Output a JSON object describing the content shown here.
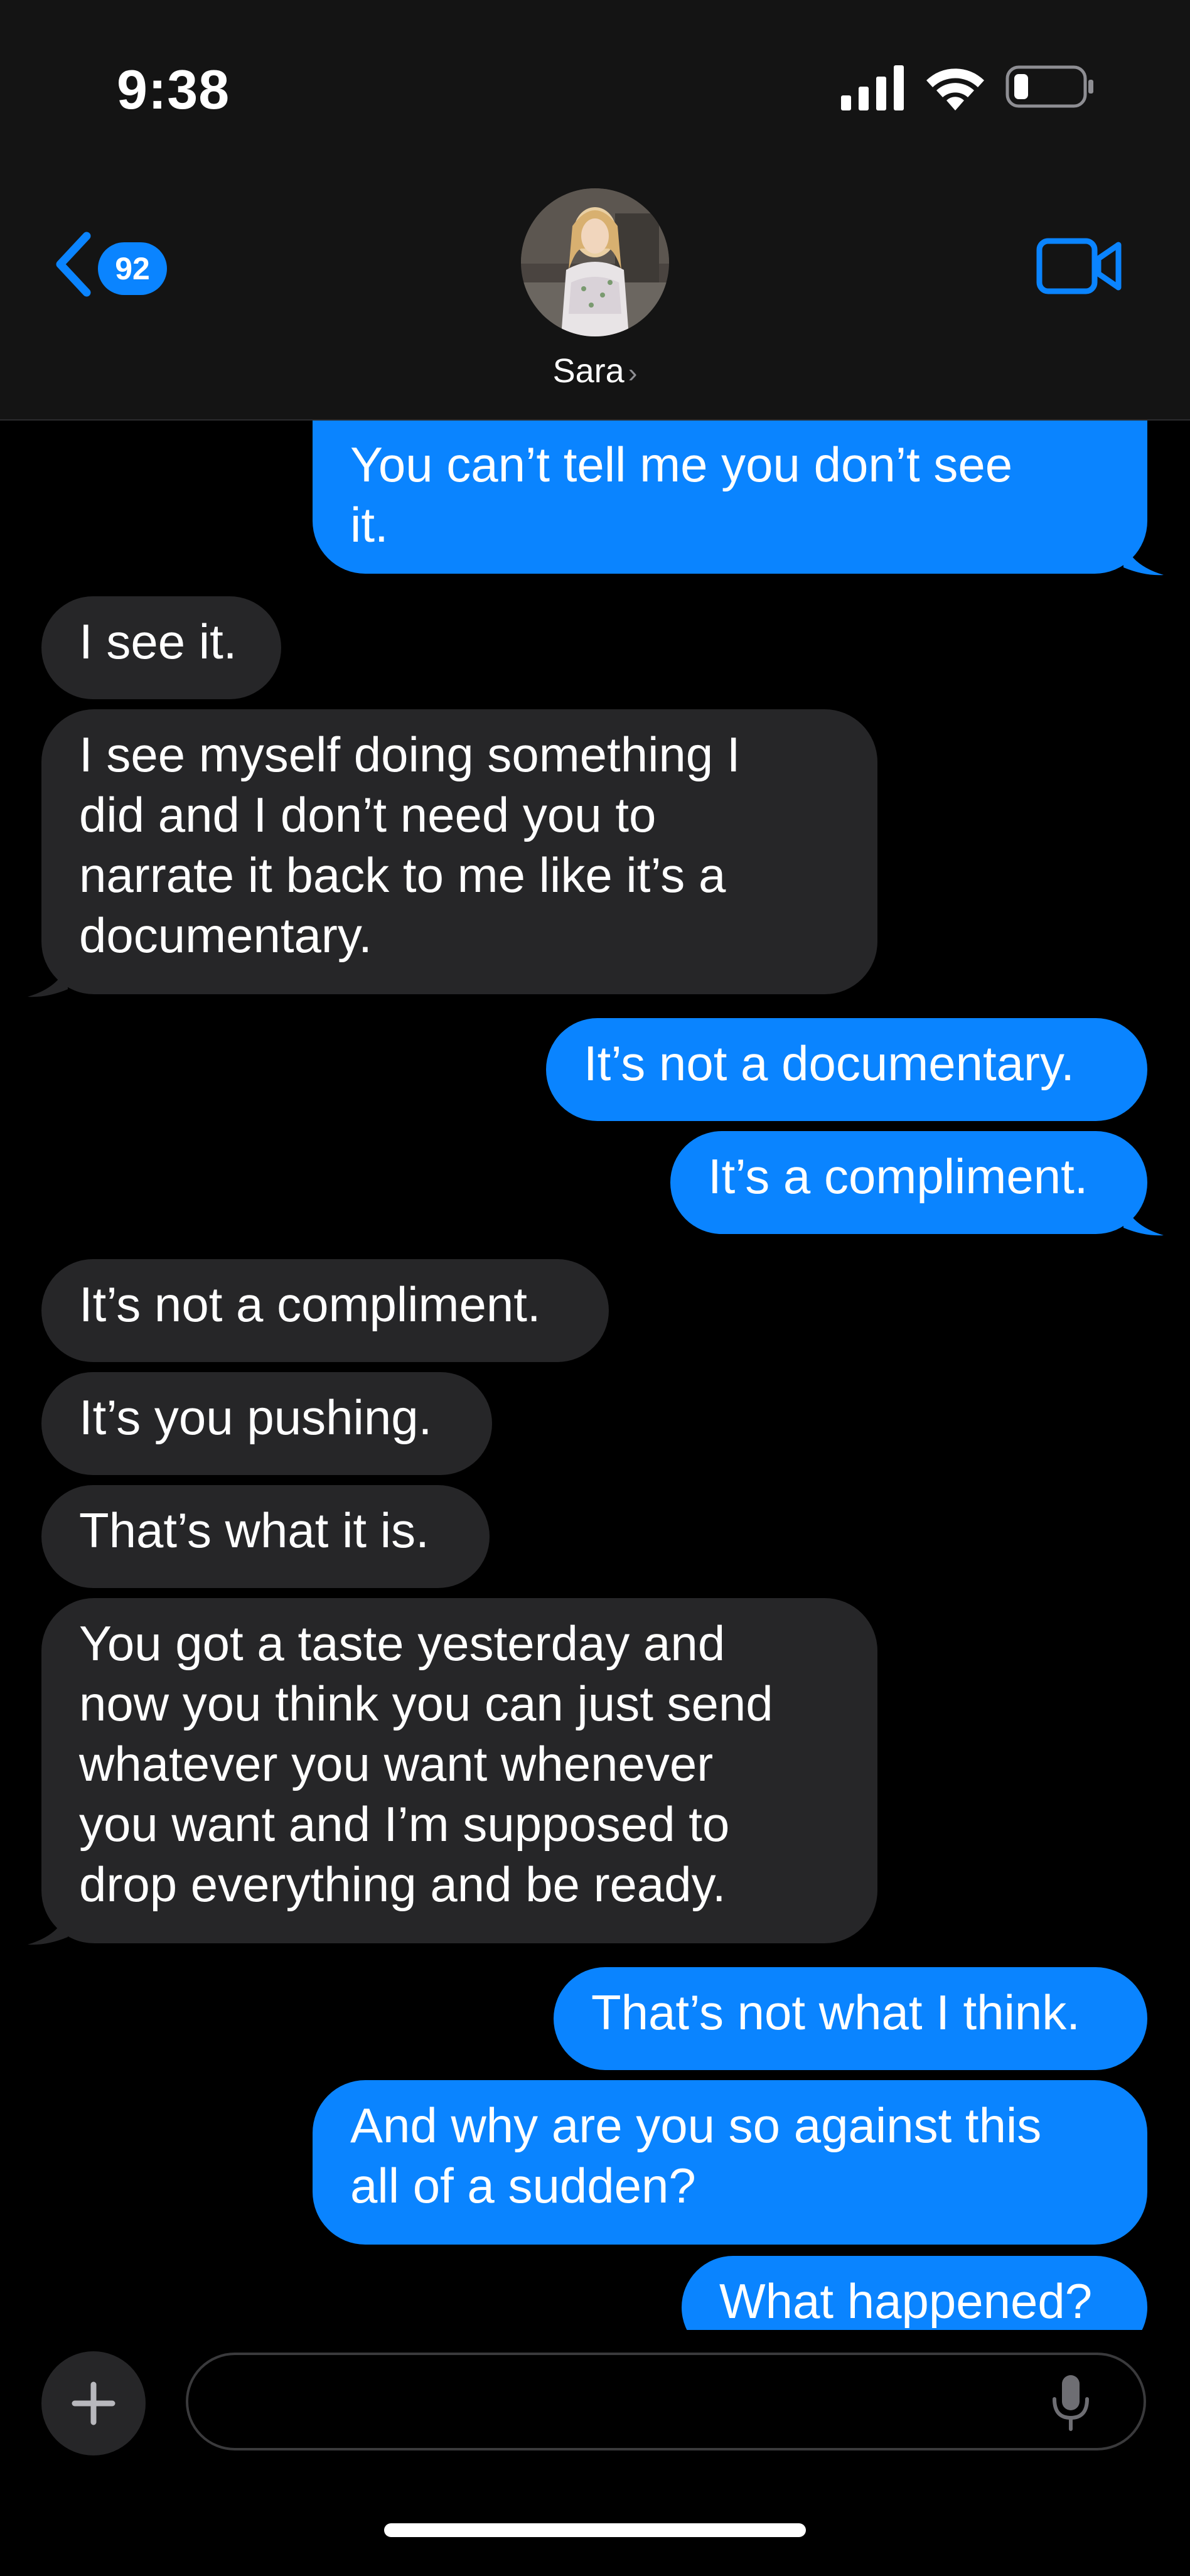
{
  "status_bar": {
    "time": "9:38"
  },
  "nav": {
    "back_badge": "92",
    "contact_name": "Sara",
    "contact_chevron": "›",
    "icons": {
      "back": "chevron-left-icon",
      "video": "video-camera-icon"
    }
  },
  "messages": [
    {
      "from": "me",
      "text": "You can’t tell me you don’t see\nit."
    },
    {
      "from": "them",
      "text": "I see it."
    },
    {
      "from": "them",
      "text": "I see myself doing something I\ndid and I don’t need you to\nnarrate it back to me like it’s a\ndocumentary."
    },
    {
      "from": "me",
      "text": "It’s not a documentary."
    },
    {
      "from": "me",
      "text": "It’s a compliment."
    },
    {
      "from": "them",
      "text": "It’s not a compliment."
    },
    {
      "from": "them",
      "text": "It’s you pushing."
    },
    {
      "from": "them",
      "text": "That’s what it is."
    },
    {
      "from": "them",
      "text": "You got a taste yesterday and\nnow you think you can just send\nwhatever you want whenever\nyou want and I’m supposed to\ndrop everything and be ready."
    },
    {
      "from": "me",
      "text": "That’s not what I think."
    },
    {
      "from": "me",
      "text": "And why are you so against this\nall of a sudden?"
    },
    {
      "from": "me",
      "text": "What happened?"
    }
  ],
  "composer": {
    "placeholder": "",
    "value": "",
    "icons": {
      "plus": "plus-icon",
      "mic": "microphone-icon"
    }
  },
  "colors": {
    "outgoing_bubble": "#0a84ff",
    "incoming_bubble": "#262628",
    "accent": "#0a84ff",
    "background": "#000000",
    "header_background": "#141414"
  }
}
